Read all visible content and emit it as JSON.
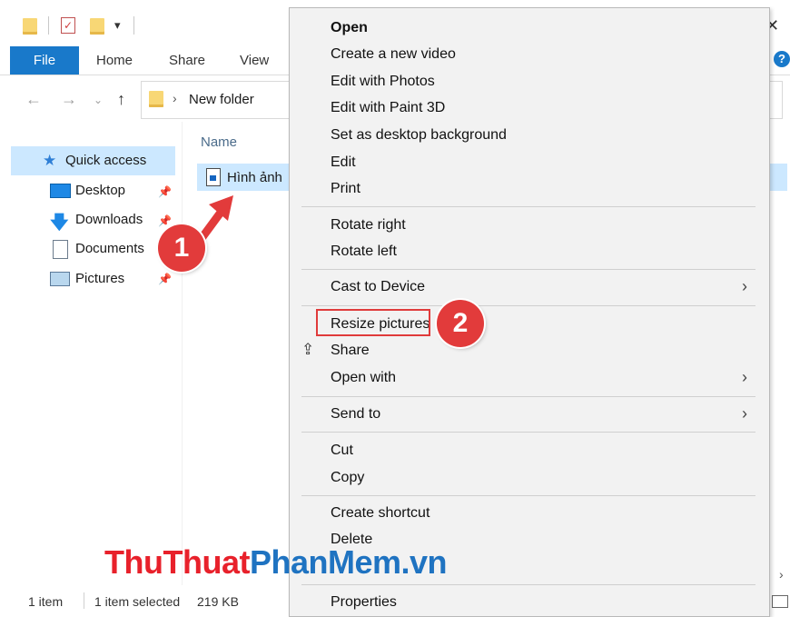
{
  "ribbon": {
    "file": "File",
    "home": "Home",
    "share": "Share",
    "view": "View"
  },
  "address": {
    "path": "New folder"
  },
  "nav": {
    "quick_access": "Quick access",
    "items": [
      "Desktop",
      "Downloads",
      "Documents",
      "Pictures"
    ]
  },
  "content": {
    "column_name": "Name",
    "file_name": "Hình ảnh"
  },
  "status": {
    "count": "1 item",
    "selected": "1 item selected",
    "size": "219 KB"
  },
  "menu": {
    "open": "Open",
    "create_video": "Create a new video",
    "edit_photos": "Edit with Photos",
    "edit_paint3d": "Edit with Paint 3D",
    "set_background": "Set as desktop background",
    "edit": "Edit",
    "print": "Print",
    "rotate_right": "Rotate right",
    "rotate_left": "Rotate left",
    "cast": "Cast to Device",
    "resize": "Resize pictures",
    "share": "Share",
    "open_with": "Open with",
    "send_to": "Send to",
    "cut": "Cut",
    "copy": "Copy",
    "create_shortcut": "Create shortcut",
    "delete": "Delete",
    "properties": "Properties"
  },
  "badges": {
    "one": "1",
    "two": "2"
  },
  "watermark": {
    "part1": "ThuThuat",
    "part2": "PhanMem",
    "part3": ".vn"
  },
  "colors": {
    "accent": "#1979ca",
    "selection": "#cce8ff",
    "badge": "#e23b3b",
    "wm_red": "#e8212b",
    "wm_blue": "#1f73c1"
  }
}
